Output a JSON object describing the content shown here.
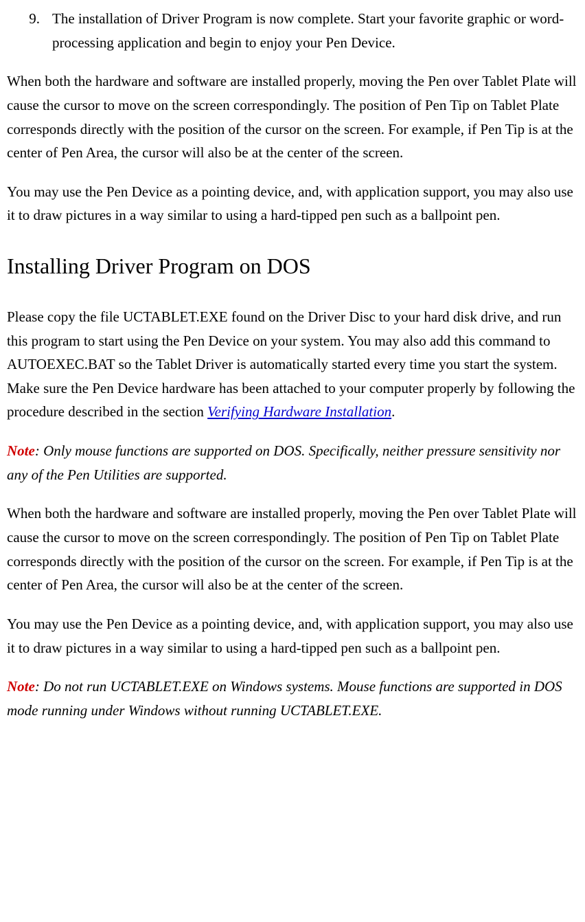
{
  "listItem": {
    "number": "9.",
    "text": "The installation of Driver Program is now complete.   Start your favorite graphic or word-processing application and begin to enjoy your Pen Device."
  },
  "para1": "When both the hardware and software are installed properly, moving the Pen over Tablet Plate will cause the cursor to move on the screen correspondingly.   The position of Pen Tip on Tablet Plate corresponds directly with the position of the cursor on the screen.   For example, if Pen Tip is at the center of Pen Area, the cursor will also be at the center of the screen.",
  "para2": "You may use the Pen Device as a pointing device, and, with application support, you may also use it to draw pictures in a way similar to using a hard-tipped pen such as a ballpoint pen.",
  "heading": "Installing Driver Program on DOS",
  "para3_pre": "Please copy the file UCTABLET.EXE found on the Driver Disc to your hard disk drive, and run this program to start using the Pen Device on your system.   You may also add this command to AUTOEXEC.BAT so the Tablet Driver is automatically started every time you start the system.   Make sure the Pen Device hardware has been attached to your computer properly by following the procedure described in the section ",
  "para3_link": "Verifying Hardware Installation",
  "para3_post": ".",
  "noteLabel": "Note",
  "note1_text": ": Only mouse functions are supported on DOS.   Specifically, neither pressure sensitivity nor any of the Pen Utilities are supported.",
  "para4": "When both the hardware and software are installed properly, moving the Pen over Tablet Plate will cause the cursor to move on the screen correspondingly.   The position of Pen Tip on Tablet Plate corresponds directly with the position of the cursor on the screen.   For example, if Pen Tip is at the center of Pen Area, the cursor will also be at the center of the screen.",
  "para5": "You may use the Pen Device as a pointing device, and, with application support, you may also use it to draw pictures in a way similar to using a hard-tipped pen such as a ballpoint pen.",
  "note2_text": ": Do not run UCTABLET.EXE on Windows systems.   Mouse functions are supported in DOS mode running under Windows without running UCTABLET.EXE."
}
